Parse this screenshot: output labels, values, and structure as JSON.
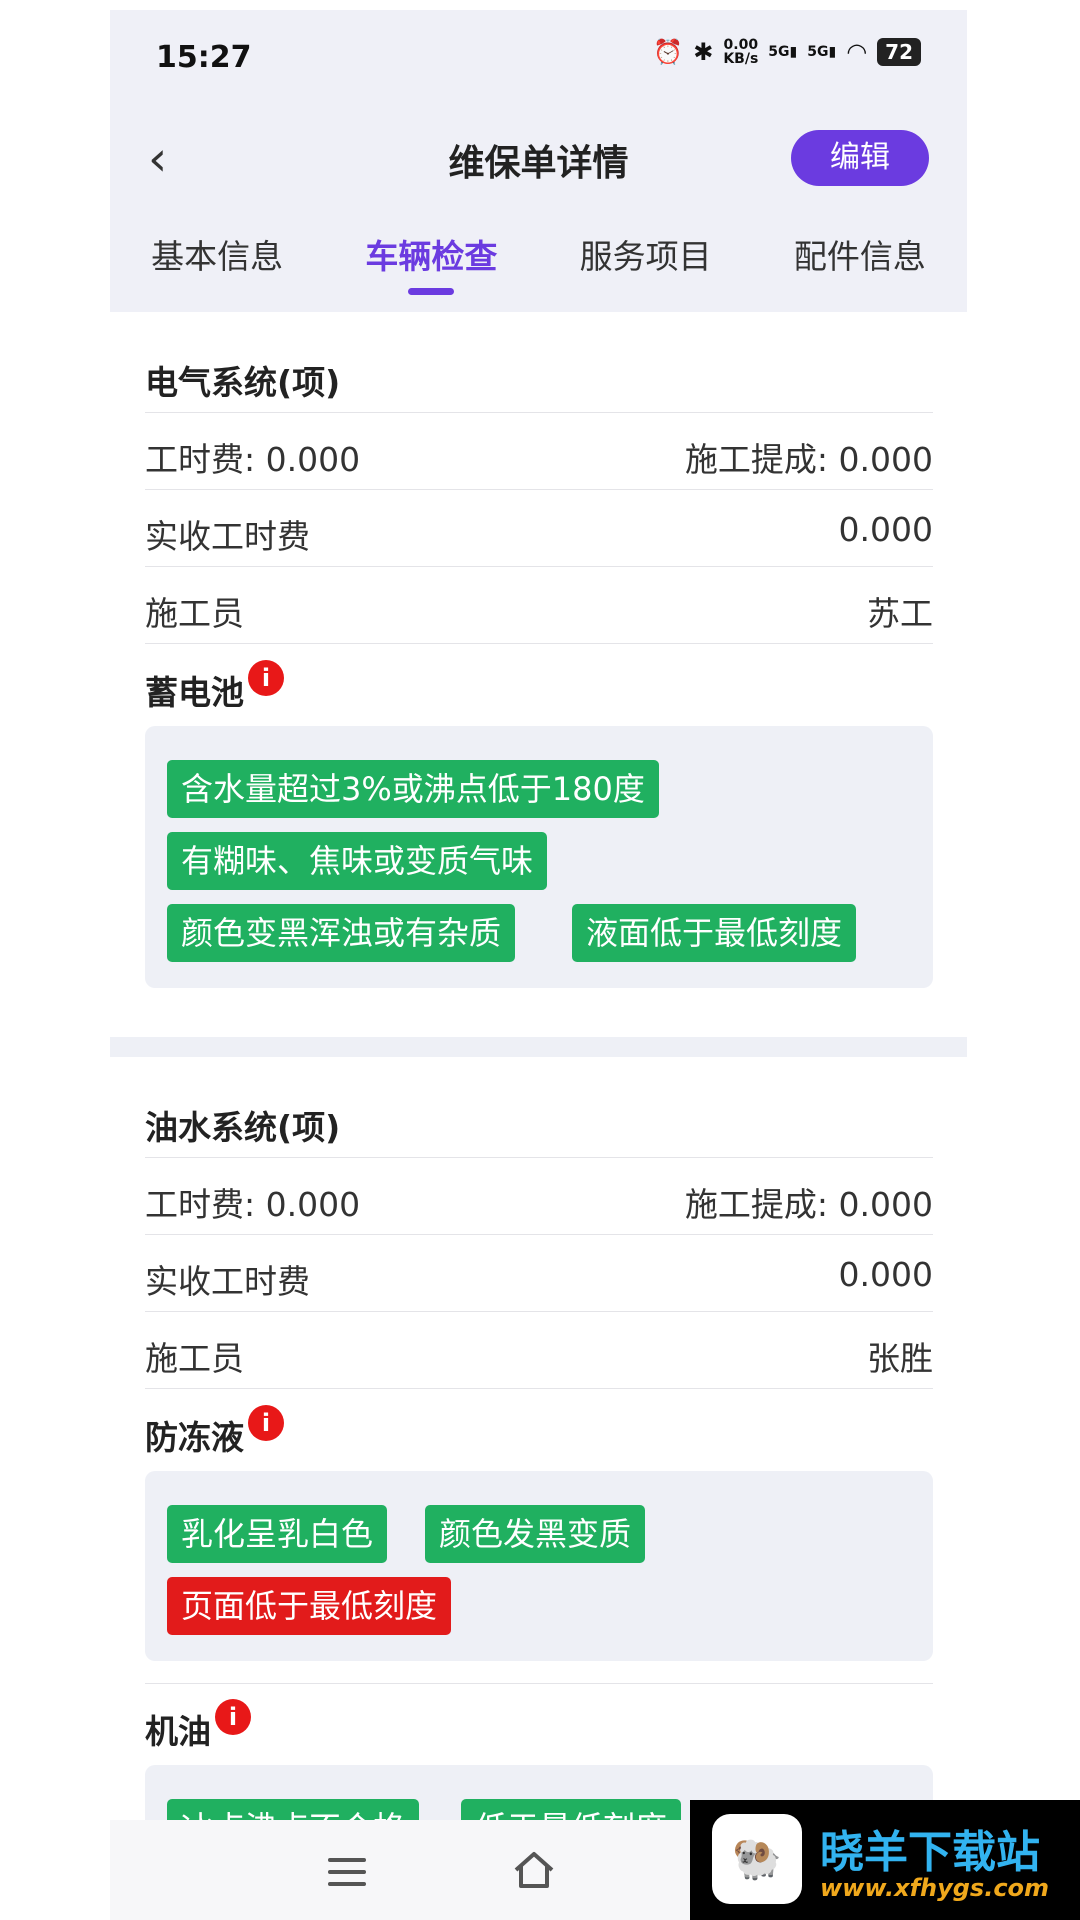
{
  "status": {
    "time": "15:27",
    "speed_value": "0.00",
    "speed_unit": "KB/s",
    "net1": "5G",
    "net2": "5G",
    "battery": "72"
  },
  "nav": {
    "back": "‹",
    "title": "维保单详情",
    "edit": "编辑"
  },
  "tabs": [
    {
      "label": "基本信息",
      "active": false
    },
    {
      "label": "车辆检查",
      "active": true
    },
    {
      "label": "服务项目",
      "active": false
    },
    {
      "label": "配件信息",
      "active": false
    }
  ],
  "sections": [
    {
      "title": "电气系统(项)",
      "labor_fee": "工时费: 0.000",
      "commission": "施工提成: 0.000",
      "actual_label": "实收工时费",
      "actual_value": "0.000",
      "worker_label": "施工员",
      "worker_value": "苏工",
      "items": [
        {
          "name": "蓄电池",
          "tags": [
            "含水量超过3%或沸点低于180度",
            "有糊味、焦味或变质气味",
            "颜色变黑浑浊或有杂质",
            "液面低于最低刻度"
          ]
        }
      ]
    },
    {
      "title": "油水系统(项)",
      "labor_fee": "工时费: 0.000",
      "commission": "施工提成: 0.000",
      "actual_label": "实收工时费",
      "actual_value": "0.000",
      "worker_label": "施工员",
      "worker_value": "张胜",
      "items": [
        {
          "name": "防冻液",
          "tags": [
            "乳化呈乳白色",
            "颜色发黑变质",
            "页面低于最低刻度"
          ]
        },
        {
          "name": "机油",
          "tags": [
            "冰点沸点不合格",
            "低于最低刻度"
          ]
        }
      ]
    }
  ],
  "info_icon": "i",
  "watermark": {
    "logo": "🐏",
    "title": "晓羊下载站",
    "url": "www.xfhygs.com"
  },
  "colors": {
    "accent": "#6b3be0",
    "tag_green": "#20b060",
    "tag_red": "#e21b1b",
    "info_red": "#e81818"
  }
}
